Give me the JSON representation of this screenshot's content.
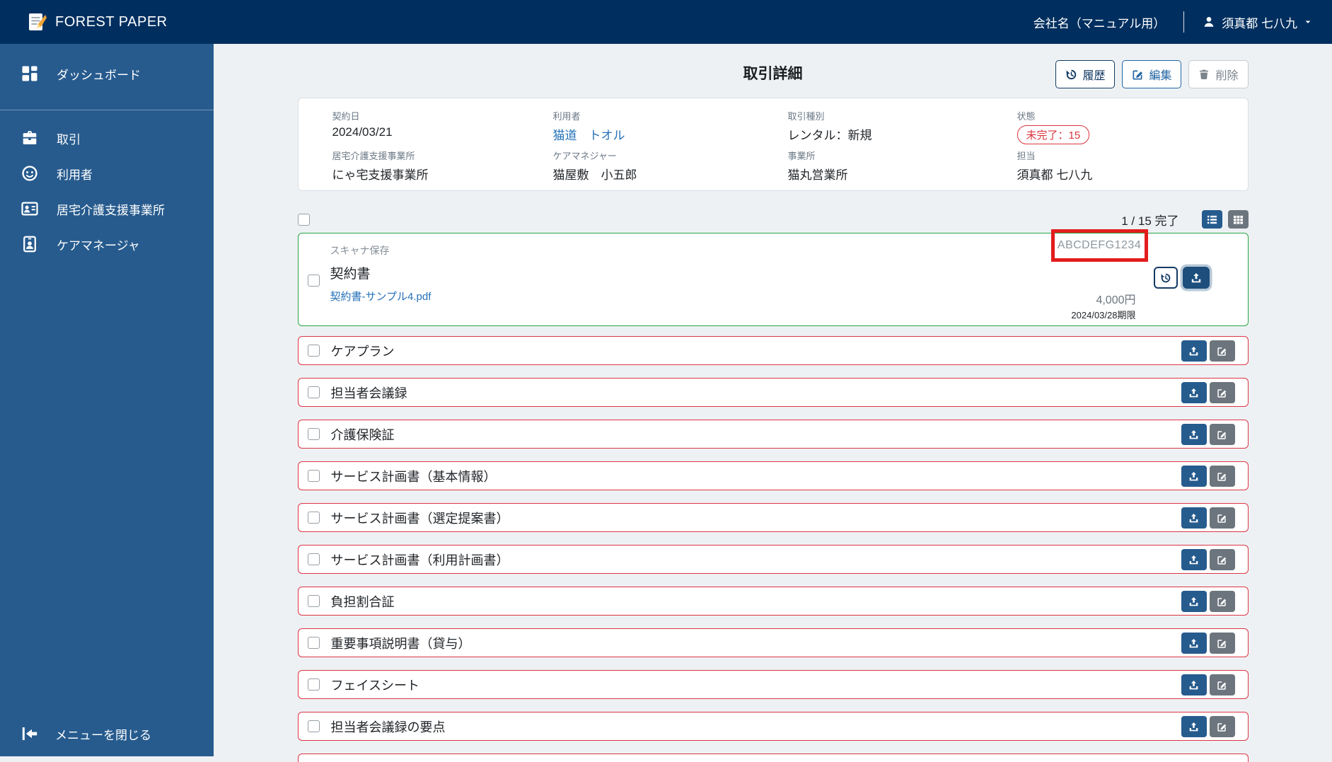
{
  "navbar": {
    "brand": "FOREST PAPER",
    "company": "会社名（マニュアル用）",
    "user": "須真都 七八九"
  },
  "sidebar": {
    "items": [
      {
        "label": "ダッシュボード",
        "icon": "dashboard-icon"
      },
      {
        "label": "取引",
        "icon": "briefcase-icon"
      },
      {
        "label": "利用者",
        "icon": "user-face-icon"
      },
      {
        "label": "居宅介護支援事業所",
        "icon": "office-card-icon"
      },
      {
        "label": "ケアマネージャ",
        "icon": "id-badge-icon"
      }
    ],
    "close_label": "メニューを閉じる"
  },
  "page": {
    "title": "取引詳細"
  },
  "actions": {
    "history": "履歴",
    "edit": "編集",
    "delete": "削除"
  },
  "details": {
    "fields": [
      {
        "label": "契約日",
        "value": "2024/03/21",
        "type": "text"
      },
      {
        "label": "利用者",
        "value": "猫道　トオル",
        "type": "link"
      },
      {
        "label": "取引種別",
        "value": "レンタル：新規",
        "type": "text"
      },
      {
        "label": "状態",
        "value": "未完了：15",
        "type": "badge"
      },
      {
        "label": "居宅介護支援事業所",
        "value": "にゃ宅支援事業所",
        "type": "text"
      },
      {
        "label": "ケアマネジャー",
        "value": "猫屋敷　小五郎",
        "type": "text"
      },
      {
        "label": "事業所",
        "value": "猫丸営業所",
        "type": "text"
      },
      {
        "label": "担当",
        "value": "須真都 七八九",
        "type": "text"
      }
    ]
  },
  "list": {
    "progress": "1 / 15 完了",
    "featured": {
      "tag": "スキャナ保存",
      "title": "契約書",
      "file": "契約書-サンプル4.pdf",
      "code": "ABCDEFG1234",
      "price": "4,000円",
      "deadline": "2024/03/28期限"
    },
    "rows": [
      "ケアプラン",
      "担当者会議録",
      "介護保険証",
      "サービス計画書（基本情報）",
      "サービス計画書（選定提案書）",
      "サービス計画書（利用計画書）",
      "負担割合証",
      "重要事項説明書（貸与）",
      "フェイスシート",
      "担当者会議録の要点"
    ]
  },
  "colors": {
    "navbar_bg": "#002f5f",
    "sidebar_bg": "#275b8e",
    "accent_blue": "#265b8e",
    "featured_border_green": "#28a745",
    "row_border_red": "#dc3545",
    "status_badge_red": "#d9363e",
    "annotation_box_red": "#e31c1c",
    "link_blue": "#2471b8",
    "edit_gray": "#6c757d"
  }
}
